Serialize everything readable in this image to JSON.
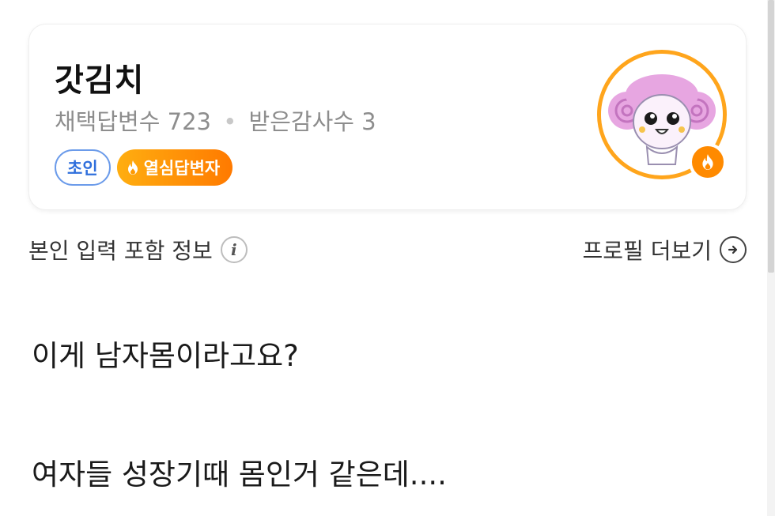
{
  "profile": {
    "username": "갓김치",
    "stats": {
      "adopted_label": "채택답변수",
      "adopted_count": "723",
      "separator": "•",
      "thanks_label": "받은감사수",
      "thanks_count": "3"
    },
    "badges": {
      "grade": "초인",
      "hot": "열심답변자"
    },
    "colors": {
      "accent_orange": "#ff8a00",
      "grade_blue": "#2f6fdc"
    }
  },
  "info_row": {
    "left_label": "본인 입력 포함 정보",
    "info_icon": "i",
    "right_label": "프로필 더보기"
  },
  "post": {
    "line1": "이게 남자몸이라고요?",
    "line2": "여자들 성장기때 몸인거 같은데...."
  }
}
